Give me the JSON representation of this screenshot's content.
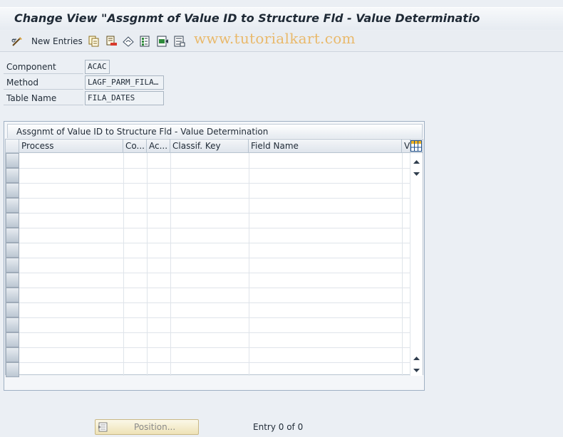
{
  "window": {
    "title": "Change View \"Assgnmt of Value ID to Structure Fld - Value Determinatio"
  },
  "toolbar": {
    "new_entries_label": "New Entries",
    "icons": [
      "glasses-pencil-icon",
      "copy-icon",
      "delete-icon",
      "undo-icon",
      "select-all-icon",
      "select-block-icon",
      "deselect-all-icon"
    ]
  },
  "watermark": "www.tutorialkart.com",
  "fields": {
    "component": {
      "label": "Component",
      "value": "ACAC"
    },
    "method": {
      "label": "Method",
      "value": "LAGF_PARM_FILA…"
    },
    "table_name": {
      "label": "Table Name",
      "value": "FILA_DATES"
    }
  },
  "table": {
    "title": "Assgnmt of Value ID to Structure Fld - Value Determination",
    "columns": [
      "Process",
      "Co...",
      "Ac...",
      "Classif. Key",
      "Field Name",
      "Va"
    ],
    "visible_row_count": 15,
    "rows": []
  },
  "footer": {
    "position_button_label": "Position...",
    "entry_info": "Entry 0 of 0"
  }
}
